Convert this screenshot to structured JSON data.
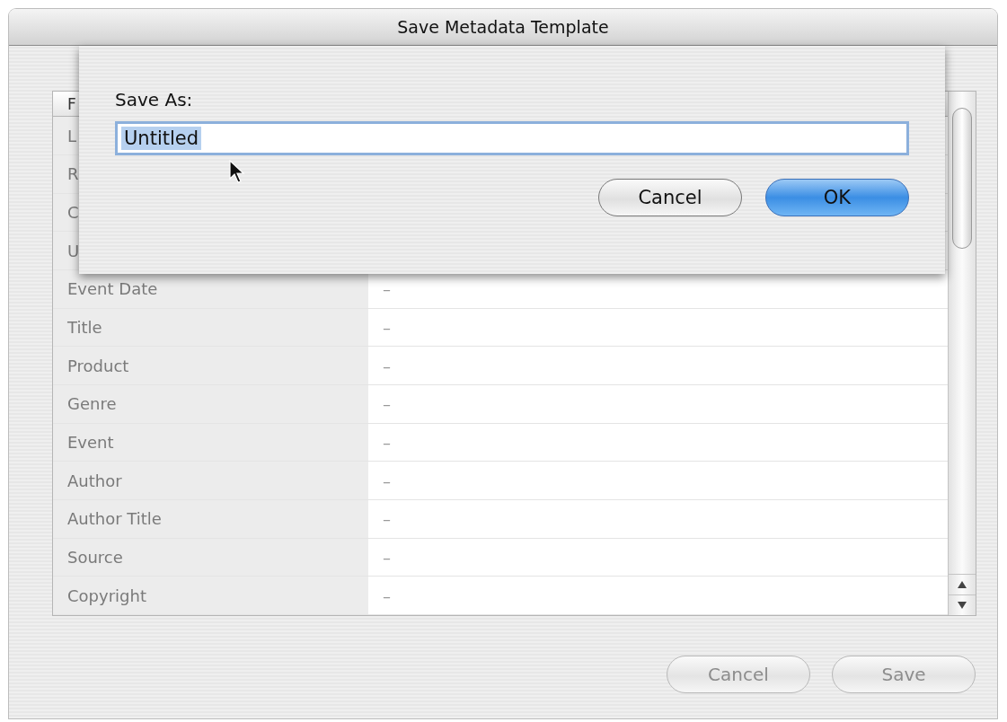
{
  "window": {
    "title": "Save Metadata Template"
  },
  "table": {
    "columns": [
      "F"
    ],
    "rows": [
      {
        "field": "L"
      },
      {
        "field": "R"
      },
      {
        "field": "C"
      },
      {
        "field": "U"
      },
      {
        "field": "Event Date",
        "value": "–"
      },
      {
        "field": "Title",
        "value": "–"
      },
      {
        "field": "Product",
        "value": "–"
      },
      {
        "field": "Genre",
        "value": "–"
      },
      {
        "field": "Event",
        "value": "–"
      },
      {
        "field": "Author",
        "value": "–"
      },
      {
        "field": "Author Title",
        "value": "–"
      },
      {
        "field": "Source",
        "value": "–"
      },
      {
        "field": "Copyright",
        "value": "–"
      }
    ]
  },
  "buttons": [
    {
      "label": "Cancel",
      "disabled": true
    },
    {
      "label": "Save",
      "disabled": true
    }
  ],
  "sheet": {
    "label": "Save As:",
    "field": {
      "value": "Untitled",
      "text_selected": true
    },
    "buttons": [
      {
        "label": "Cancel",
        "default": false
      },
      {
        "label": "OK",
        "default": true
      }
    ]
  }
}
